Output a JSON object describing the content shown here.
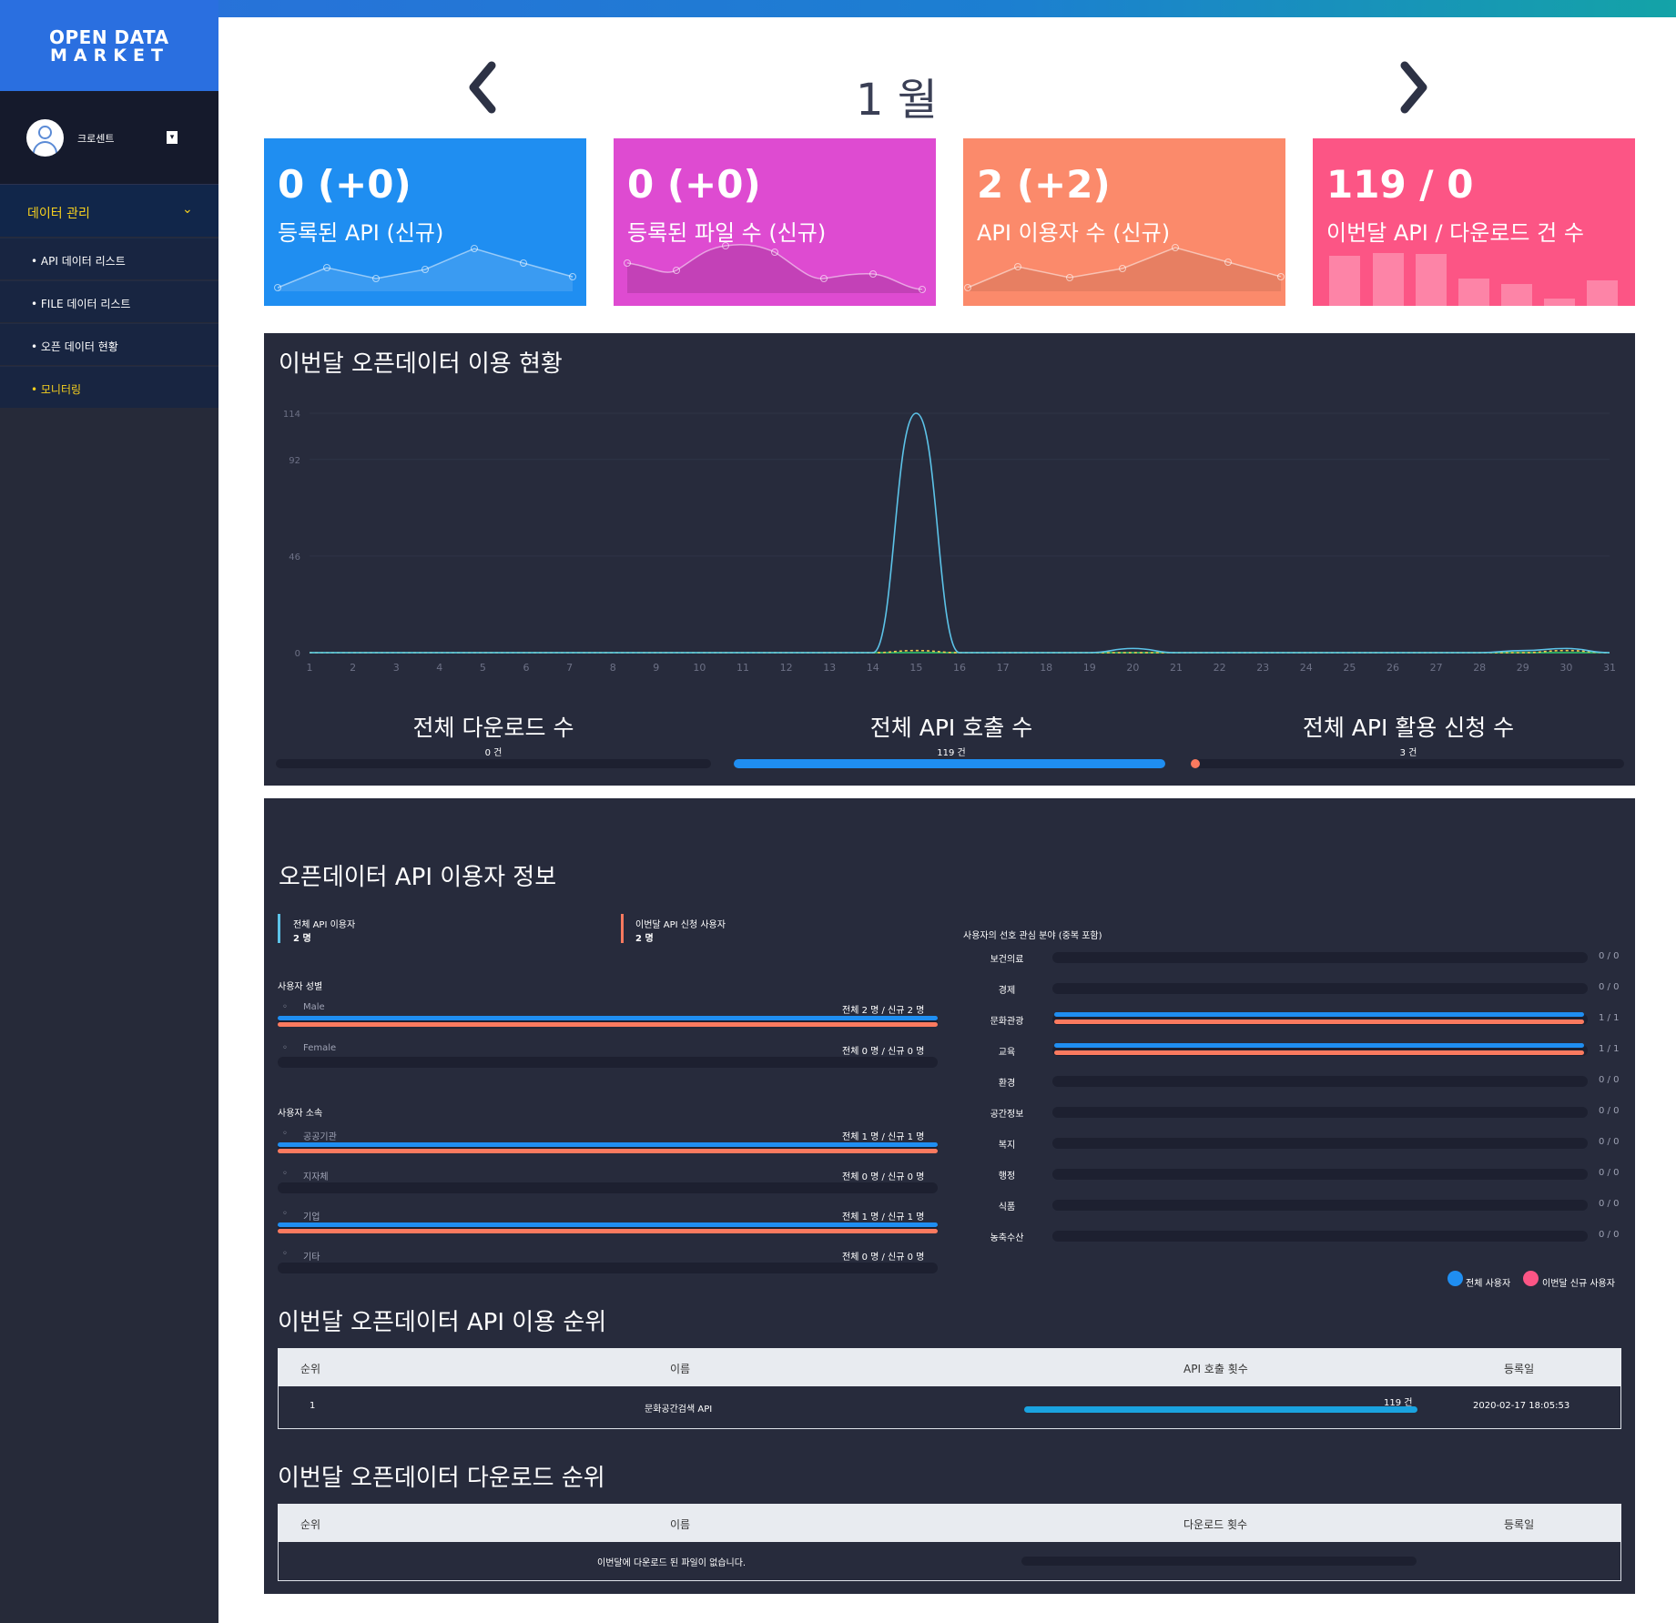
{
  "brand": {
    "line1": "OPEN DATA",
    "line2": "MARKET"
  },
  "user": {
    "name": "크로센트"
  },
  "sidebar": {
    "section": "데이터 관리",
    "items": [
      {
        "label": "• API 데이터 리스트"
      },
      {
        "label": "• FILE 데이터 리스트"
      },
      {
        "label": "• 오픈 데이터 현황"
      },
      {
        "label": "• 모니터링"
      }
    ]
  },
  "month_nav": {
    "label": "1 월"
  },
  "cards": [
    {
      "value": "0 (+0)",
      "label": "등록된 API (신규)",
      "color": "#1f8ef1"
    },
    {
      "value": "0 (+0)",
      "label": "등록된 파일 수 (신규)",
      "color": "#de4bd1"
    },
    {
      "value": "2 (+2)",
      "label": "API 이용자 수 (신규)",
      "color": "#fb8a6b"
    },
    {
      "value": "119 / 0",
      "label": "이번달 API / 다운로드 건 수",
      "color": "#fc5585"
    }
  ],
  "usage_panel": {
    "title": "이번달 오픈데이터 이용 현황",
    "stats": [
      {
        "title": "전체 다운로드 수",
        "sub": "0 건",
        "fill": 0.0,
        "color": "#1f8ef1"
      },
      {
        "title": "전체 API 호출 수",
        "sub": "119 건",
        "fill": 1.0,
        "color": "#1f8ef1"
      },
      {
        "title": "전체 API 활용 신청 수",
        "sub": "3 건",
        "fill": 0.02,
        "color": "#fb7a5f"
      }
    ]
  },
  "chart_data": {
    "type": "line",
    "x": [
      1,
      2,
      3,
      4,
      5,
      6,
      7,
      8,
      9,
      10,
      11,
      12,
      13,
      14,
      15,
      16,
      17,
      18,
      19,
      20,
      21,
      22,
      23,
      24,
      25,
      26,
      27,
      28,
      29,
      30,
      31
    ],
    "yticks": [
      0,
      46,
      92,
      114
    ],
    "ylim": [
      0,
      114
    ],
    "series": [
      {
        "color": "#5cc3e8",
        "values": [
          0,
          0,
          0,
          0,
          0,
          0,
          0,
          0,
          0,
          0,
          0,
          0,
          0,
          0,
          114,
          0,
          0,
          0,
          0,
          2,
          0,
          0,
          0,
          0,
          0,
          0,
          0,
          0,
          1,
          2,
          0
        ]
      },
      {
        "color": "#f2c94c",
        "values": [
          0,
          0,
          0,
          0,
          0,
          0,
          0,
          0,
          0,
          0,
          0,
          0,
          0,
          0,
          1,
          0,
          0,
          0,
          0,
          0,
          0,
          0,
          0,
          0,
          0,
          0,
          0,
          0,
          0,
          1,
          0
        ]
      },
      {
        "color": "#2ecc71",
        "values": [
          0,
          0,
          0,
          0,
          0,
          0,
          0,
          0,
          0,
          0,
          0,
          0,
          0,
          0,
          0,
          0,
          0,
          0,
          0,
          0,
          0,
          0,
          0,
          0,
          0,
          0,
          0,
          0,
          0,
          0,
          0
        ]
      }
    ]
  },
  "users_panel": {
    "title": "오픈데이터 API 이용자 정보",
    "total_label": "전체 API 이용자",
    "total_value": "2 명",
    "new_label": "이번달 API 신청 사용자",
    "new_value": "2 명",
    "gender_title": "사용자 성별",
    "gender": [
      {
        "label": "Male",
        "stat": "전체 2 명 / 신규 2 명",
        "total": 1.0,
        "new": 1.0
      },
      {
        "label": "Female",
        "stat": "전체 0 명 / 신규 0 명",
        "total": 0,
        "new": 0
      }
    ],
    "org_title": "사용자 소속",
    "orgs": [
      {
        "label": "공공기관",
        "stat": "전체 1 명 / 신규 1 명",
        "total": 1.0,
        "new": 1.0
      },
      {
        "label": "지자체",
        "stat": "전체 0 명 / 신규 0 명",
        "total": 0,
        "new": 0
      },
      {
        "label": "기업",
        "stat": "전체 1 명 / 신규 1 명",
        "total": 1.0,
        "new": 1.0
      },
      {
        "label": "기타",
        "stat": "전체 0 명 / 신규 0 명",
        "total": 0,
        "new": 0
      }
    ],
    "interest_title": "사용자의 선호 관심 분야 (중복 포함)",
    "interests": [
      {
        "label": "보건의료",
        "stat": "0 / 0",
        "total": 0,
        "new": 0
      },
      {
        "label": "경제",
        "stat": "0 / 0",
        "total": 0,
        "new": 0
      },
      {
        "label": "문화관광",
        "stat": "1 / 1",
        "total": 1.0,
        "new": 1.0
      },
      {
        "label": "교육",
        "stat": "1 / 1",
        "total": 1.0,
        "new": 1.0
      },
      {
        "label": "환경",
        "stat": "0 / 0",
        "total": 0,
        "new": 0
      },
      {
        "label": "공간정보",
        "stat": "0 / 0",
        "total": 0,
        "new": 0
      },
      {
        "label": "복지",
        "stat": "0 / 0",
        "total": 0,
        "new": 0
      },
      {
        "label": "행정",
        "stat": "0 / 0",
        "total": 0,
        "new": 0
      },
      {
        "label": "식품",
        "stat": "0 / 0",
        "total": 0,
        "new": 0
      },
      {
        "label": "농축수산",
        "stat": "0 / 0",
        "total": 0,
        "new": 0
      }
    ],
    "legend": [
      {
        "label": "전체 사용자",
        "color": "#1f8ef1"
      },
      {
        "label": "이번달 신규 사용자",
        "color": "#fc5585"
      }
    ]
  },
  "api_rank": {
    "title": "이번달 오픈데이터 API 이용 순위",
    "headers": [
      "순위",
      "이름",
      "API 호출 횟수",
      "등록일"
    ],
    "rows": [
      {
        "rank": "1",
        "name": "문화공간검색 API",
        "count": "119 건",
        "fill": 1.0,
        "date": "2020-02-17 18:05:53"
      }
    ]
  },
  "download_rank": {
    "title": "이번달 오픈데이터 다운로드 순위",
    "headers": [
      "순위",
      "이름",
      "다운로드 횟수",
      "등록일"
    ],
    "empty": "이번달에 다운로드 된 파일이 없습니다."
  },
  "colors": {
    "blue": "#1f8ef1",
    "salmon": "#fb7a5f",
    "panel": "#272b3c"
  }
}
